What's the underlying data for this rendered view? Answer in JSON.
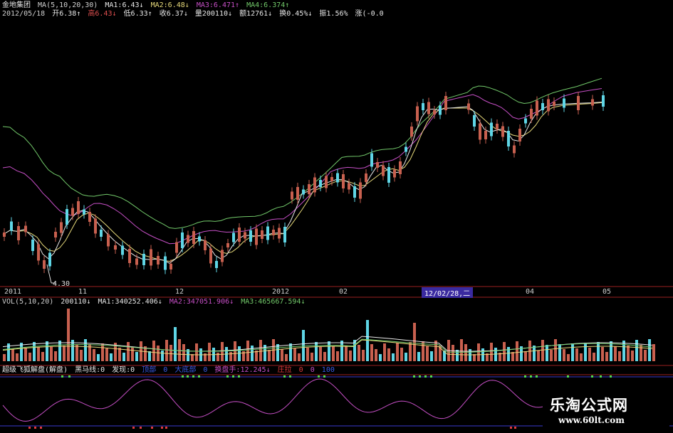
{
  "header": {
    "name": "金地集团",
    "ma_params": "MA(5,10,20,30)",
    "ma1": "MA1:6.43",
    "ma2": "MA2:6.48",
    "ma3": "MA3:6.471",
    "ma4": "MA4:6.374",
    "arrow_down": "↓",
    "arrow_up": "↑",
    "date": "2012/05/18",
    "open": "开6.38",
    "high": "高6.43",
    "low": "低6.33",
    "close": "收6.37",
    "volume": "量200110",
    "amount": "额12761",
    "turnover": "换0.45%",
    "amplitude": "振1.56%",
    "change": "涨(-0.0"
  },
  "colors": {
    "up": "#c8604f",
    "down": "#5fd6e6",
    "ma5": "#e8e8e8",
    "ma10": "#e6d97a",
    "ma20": "#c64fc6",
    "ma30": "#72c96a",
    "osc": "#c64fc6",
    "marker_green": "#4fdc4f",
    "marker_red": "#e03a3a"
  },
  "price_panel": {
    "low_label": "4.30"
  },
  "date_axis": [
    "2011",
    "11",
    "12",
    "2012",
    "02",
    "04",
    "05"
  ],
  "cursor_date": "12/02/28,二",
  "volume_panel": {
    "params": "VOL(5,10,20)",
    "value": "200110",
    "ma1": "MA1:340252.406",
    "ma2": "MA2:347051.906",
    "ma3": "MA3:465667.594"
  },
  "indicator_panel": {
    "name": "超级飞狐解盘(解盘)",
    "black_horse": "黑马线:0",
    "found": "发现:0",
    "item1": "顶部",
    "item1_val": "0",
    "item2": "大底部",
    "item2_val": "0",
    "turnover": "换盘手:12.245",
    "pull": "庄拉",
    "pull_val1": "0",
    "pull_val2": "0",
    "pull_val3": "100"
  },
  "watermark": {
    "title": "乐淘公式网",
    "url": "www.60lt.com"
  },
  "chart_data": {
    "type": "line",
    "title": "",
    "series": [
      {
        "name": "MA1",
        "values": [
          6.43
        ]
      },
      {
        "name": "MA2",
        "values": [
          6.48
        ]
      },
      {
        "name": "MA3",
        "values": [
          6.471
        ]
      },
      {
        "name": "MA4",
        "values": [
          6.374
        ]
      }
    ],
    "volume_series": [
      {
        "name": "MA1",
        "values": [
          340252.406
        ]
      },
      {
        "name": "MA2",
        "values": [
          347051.906
        ]
      },
      {
        "name": "MA3",
        "values": [
          465667.594
        ]
      }
    ],
    "candles_sample": [
      {
        "date": "2012/05/18",
        "open": 6.38,
        "high": 6.43,
        "low": 6.33,
        "close": 6.37,
        "volume": 200110
      }
    ],
    "x_ticks": [
      "2011",
      "11",
      "12",
      "2012",
      "02",
      "04",
      "05"
    ],
    "low_annotation": 4.3,
    "grid": false,
    "legend": "top-left"
  }
}
